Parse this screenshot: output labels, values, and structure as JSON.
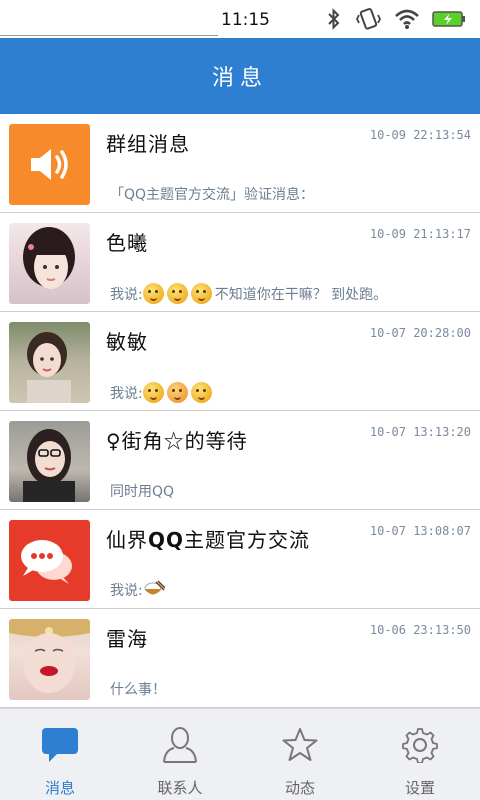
{
  "status": {
    "time": "11:15",
    "icons": [
      "bluetooth-icon",
      "vibrate-icon",
      "wifi-icon",
      "battery-charging-icon"
    ]
  },
  "header": {
    "title": "消息"
  },
  "conversations": [
    {
      "name": "群组消息",
      "time": "10-09 22:13:54",
      "preview": "「QQ主题官方交流」验证消息：",
      "emojis": [],
      "avatar": "speaker-icon"
    },
    {
      "name": "色曦",
      "time": "10-09 21:13:17",
      "preview_prefix": "我说:",
      "emojis": [
        "grin",
        "grin",
        "grin"
      ],
      "preview": "不知道你在干嘛？ 到处跑。",
      "avatar": "photo-girl-1"
    },
    {
      "name": "敏敏",
      "time": "10-07 20:28:00",
      "preview_prefix": "我说:",
      "emojis": [
        "smile",
        "angry",
        "grin"
      ],
      "preview": "",
      "avatar": "photo-girl-2"
    },
    {
      "name": "♀街角☆的等待",
      "time": "10-07 13:13:20",
      "preview": "同时用QQ",
      "emojis": [],
      "avatar": "photo-girl-3"
    },
    {
      "name": "仙界QQ主题官方交流",
      "name_plain": "仙界",
      "name_bold": "QQ",
      "name_rest": "主题官方交流",
      "time": "10-07 13:08:07",
      "preview_prefix": "我说:",
      "emojis": [
        "rice"
      ],
      "preview": "",
      "avatar": "chat-bubbles-icon"
    },
    {
      "name": "雷海",
      "time": "10-06 23:13:50",
      "preview": "什么事！",
      "emojis": [],
      "avatar": "photo-girl-4"
    }
  ],
  "tabs": [
    {
      "label": "消息",
      "icon": "chat-bubble-icon",
      "active": true
    },
    {
      "label": "联系人",
      "icon": "person-icon",
      "active": false
    },
    {
      "label": "动态",
      "icon": "star-icon",
      "active": false
    },
    {
      "label": "设置",
      "icon": "gear-icon",
      "active": false
    }
  ],
  "colors": {
    "accent": "#2e7fd1",
    "time_text": "#7b8aa0",
    "preview_text": "#6c7e92"
  }
}
